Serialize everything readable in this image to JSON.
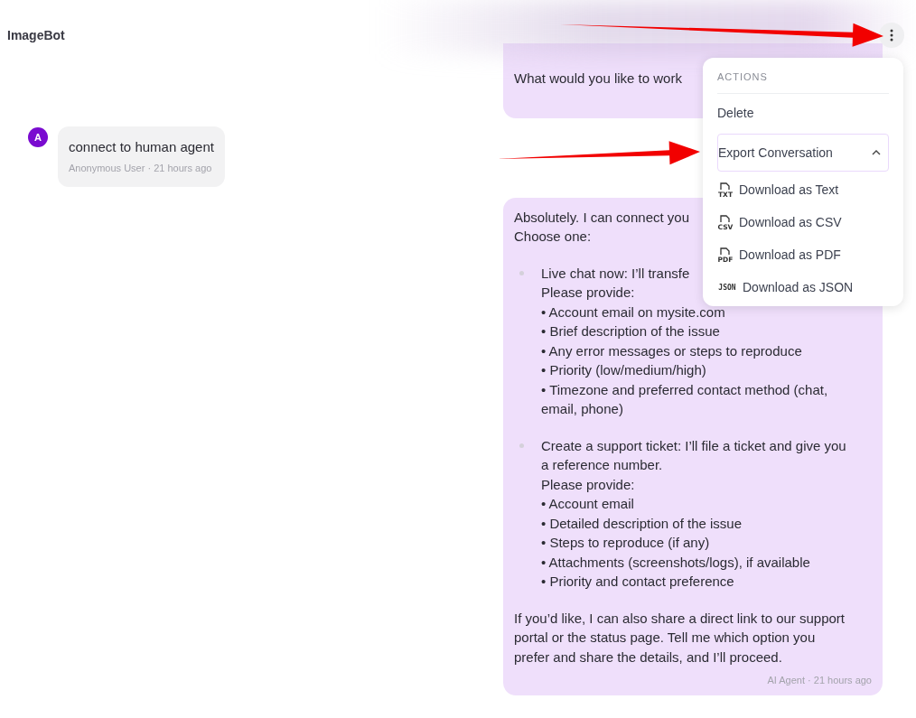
{
  "app": {
    "title": "ImageBot"
  },
  "messages": [
    {
      "kind": "agent",
      "blocks": [
        {
          "kind": "paragraph",
          "lines": [
            "What would you like to work"
          ]
        }
      ]
    },
    {
      "kind": "user",
      "avatar": "A",
      "text": "connect to human agent",
      "author": "Anonymous User",
      "separator": "·",
      "time": "21 hours ago"
    },
    {
      "kind": "agent",
      "author": "AI Agent",
      "separator": "·",
      "time": "21 hours ago",
      "blocks": [
        {
          "kind": "paragraph",
          "lines": [
            "Absolutely. I can connect you",
            "Choose one:"
          ]
        },
        {
          "kind": "option",
          "lines": [
            "Live chat now: I’ll transfe"
          ],
          "prompt": "Please provide:",
          "items": [
            "• Account email on mysite.com",
            "• Brief description of the issue",
            "• Any error messages or steps to reproduce",
            "• Priority (low/medium/high)",
            "• Timezone and preferred contact method (chat,\nemail, phone)"
          ]
        },
        {
          "kind": "option",
          "lines": [
            "Create a support ticket: I’ll file a ticket and give you",
            "a reference number."
          ],
          "prompt": "Please provide:",
          "items": [
            "• Account email",
            "• Detailed description of the issue",
            "• Steps to reproduce (if any)",
            "• Attachments (screenshots/logs), if available",
            "• Priority and contact preference"
          ]
        },
        {
          "kind": "paragraph",
          "lines": [
            "If you’d like, I can also share a direct link to our support",
            "portal or the status page. Tell me which option you",
            "prefer and share the details, and I’ll proceed."
          ]
        }
      ]
    }
  ],
  "menu": {
    "heading": "ACTIONS",
    "items": [
      {
        "kind": "action",
        "label": "Delete"
      },
      {
        "kind": "group",
        "label": "Export Conversation",
        "expanded": true,
        "children": [
          {
            "kind": "file",
            "label": "Download as Text",
            "icon_text": "TXT"
          },
          {
            "kind": "file",
            "label": "Download as CSV",
            "icon_text": "CSV"
          },
          {
            "kind": "file",
            "label": "Download as PDF",
            "icon_text": "PDF"
          },
          {
            "kind": "code",
            "label": "Download as JSON",
            "icon_text": "JSON"
          }
        ]
      }
    ]
  },
  "annotations": [
    {
      "kind": "arrow"
    },
    {
      "kind": "arrow"
    }
  ]
}
